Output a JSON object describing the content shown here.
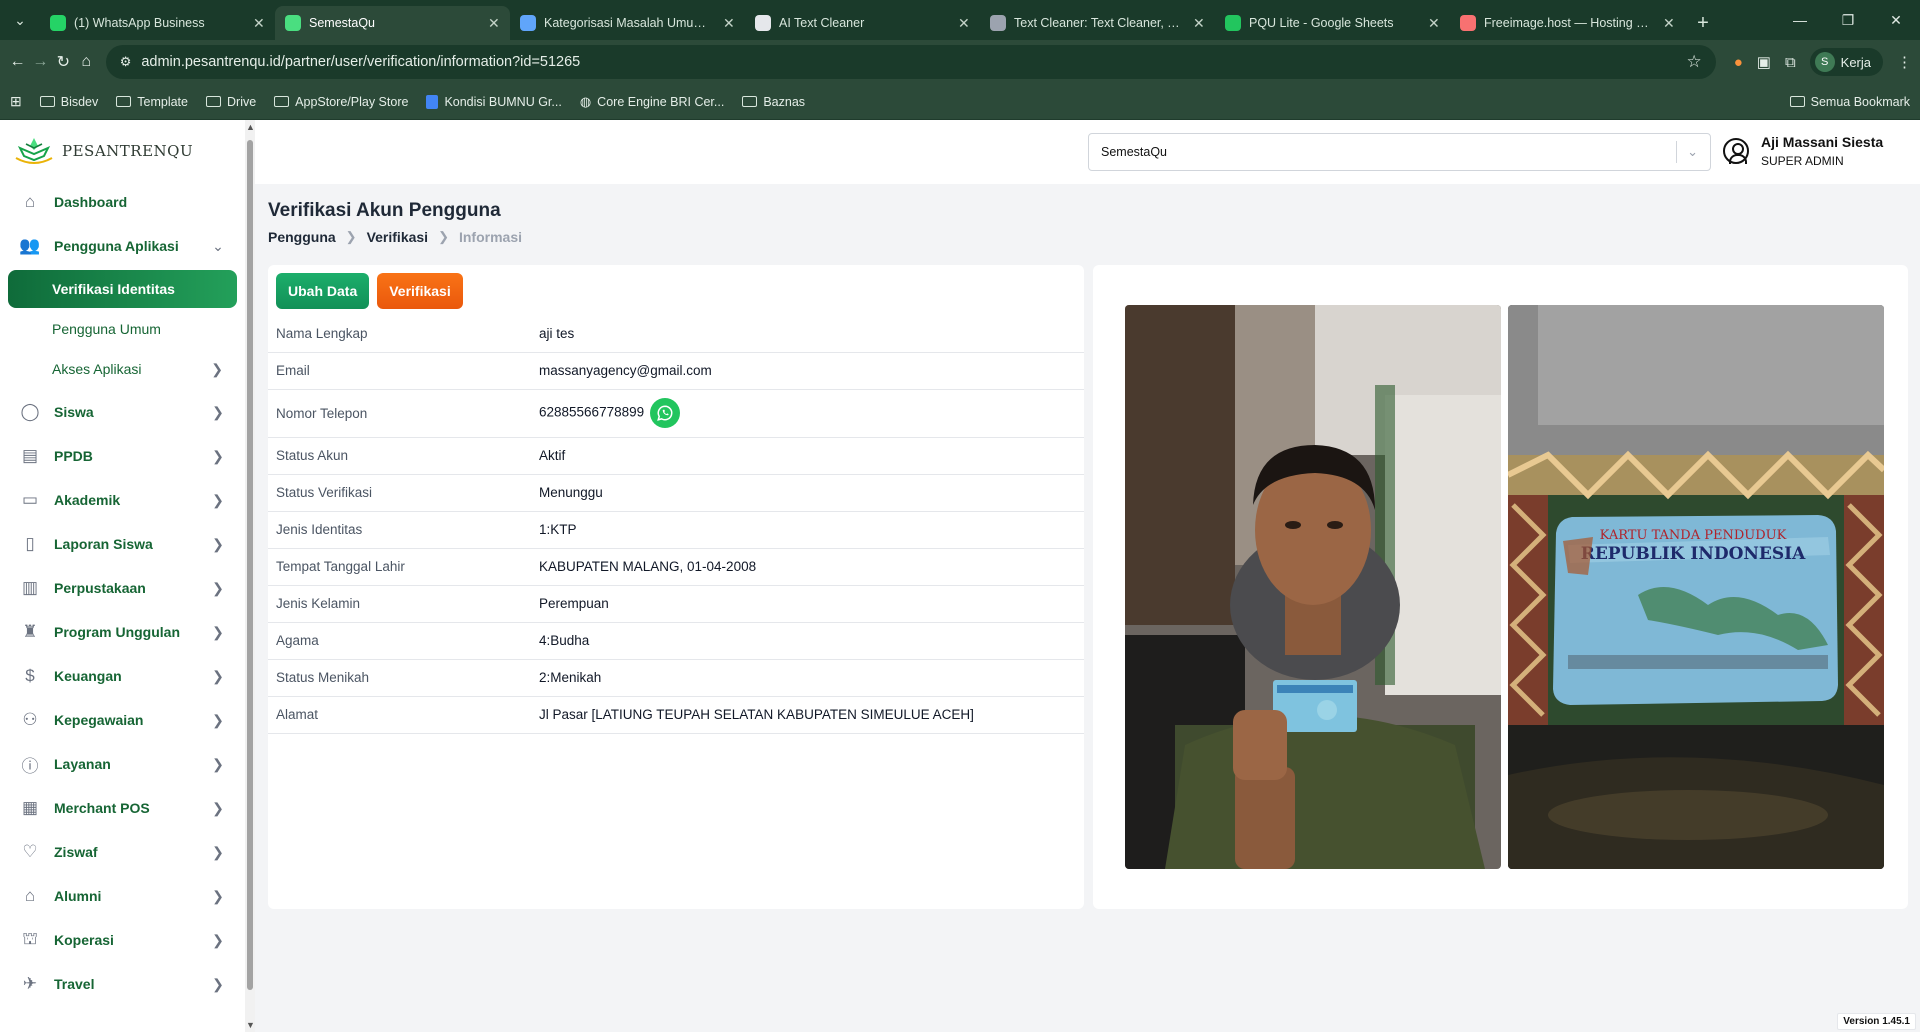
{
  "browser": {
    "tabs": [
      {
        "title": "(1) WhatsApp Business",
        "favicon": "whatsapp-icon",
        "color": "#25d366",
        "active": false
      },
      {
        "title": "SemestaQu",
        "favicon": "pesantrenqu-icon",
        "color": "#4ade80",
        "active": true
      },
      {
        "title": "Kategorisasi Masalah Umum Sh",
        "favicon": "gemini-icon",
        "color": "#60a5fa",
        "active": false
      },
      {
        "title": "AI Text Cleaner",
        "favicon": "brush-icon",
        "color": "#e5e7eb",
        "active": false
      },
      {
        "title": "Text Cleaner: Text Cleaner, Text",
        "favicon": "document-icon",
        "color": "#9ca3af",
        "active": false
      },
      {
        "title": "PQU Lite - Google Sheets",
        "favicon": "sheets-icon",
        "color": "#22c55e",
        "active": false
      },
      {
        "title": "Freeimage.host — Hosting Gam",
        "favicon": "freeimage-icon",
        "color": "#f87171",
        "active": false
      }
    ],
    "url": "admin.pesantrenqu.id/partner/user/verification/information?id=51265",
    "profile_label": "Kerja",
    "profile_initial": "S",
    "bookmarks": [
      {
        "label": "Bisdev",
        "icon": "folder-icon"
      },
      {
        "label": "Template",
        "icon": "folder-icon"
      },
      {
        "label": "Drive",
        "icon": "folder-icon"
      },
      {
        "label": "AppStore/Play Store",
        "icon": "folder-icon"
      },
      {
        "label": "Kondisi BUMNU Gr...",
        "icon": "docs-icon"
      },
      {
        "label": "Core Engine BRI Cer...",
        "icon": "globe-icon"
      },
      {
        "label": "Baznas",
        "icon": "folder-icon"
      }
    ],
    "bookmarks_all": "Semua Bookmark"
  },
  "app": {
    "logo_text": "PESANTRENQU",
    "brand_color": "#15803d",
    "sidebar": {
      "items": [
        {
          "label": "Dashboard",
          "icon": "home-icon",
          "chevron": false
        },
        {
          "label": "Pengguna Aplikasi",
          "icon": "users-icon",
          "chevron": "down"
        },
        {
          "label": "Siswa",
          "icon": "user-icon",
          "chevron": "right"
        },
        {
          "label": "PPDB",
          "icon": "clipboard-icon",
          "chevron": "right"
        },
        {
          "label": "Akademik",
          "icon": "doc-icon",
          "chevron": "right"
        },
        {
          "label": "Laporan Siswa",
          "icon": "report-icon",
          "chevron": "right"
        },
        {
          "label": "Perpustakaan",
          "icon": "book-icon",
          "chevron": "right"
        },
        {
          "label": "Program Unggulan",
          "icon": "trophy-icon",
          "chevron": "right"
        },
        {
          "label": "Keuangan",
          "icon": "dollar-icon",
          "chevron": "right"
        },
        {
          "label": "Kepegawaian",
          "icon": "staff-icon",
          "chevron": "right"
        },
        {
          "label": "Layanan",
          "icon": "info-icon",
          "chevron": "right"
        },
        {
          "label": "Merchant POS",
          "icon": "store-icon",
          "chevron": "right"
        },
        {
          "label": "Ziswaf",
          "icon": "heart-icon",
          "chevron": "right"
        },
        {
          "label": "Alumni",
          "icon": "graduation-icon",
          "chevron": "right"
        },
        {
          "label": "Koperasi",
          "icon": "bank-icon",
          "chevron": "right"
        },
        {
          "label": "Travel",
          "icon": "plane-icon",
          "chevron": "right"
        }
      ],
      "submenu": [
        {
          "label": "Verifikasi Identitas",
          "active": true
        },
        {
          "label": "Pengguna Umum",
          "active": false
        },
        {
          "label": "Akses Aplikasi",
          "active": false
        }
      ]
    },
    "topbar": {
      "selected_school": "SemestaQu",
      "user_name": "Aji Massani Siesta",
      "user_role": "SUPER ADMIN"
    },
    "page": {
      "title": "Verifikasi Akun Pengguna",
      "breadcrumb": [
        "Pengguna",
        "Verifikasi",
        "Informasi"
      ]
    },
    "actions": {
      "edit_label": "Ubah Data",
      "verify_label": "Verifikasi"
    },
    "details": [
      {
        "label": "Nama Lengkap",
        "value": "aji tes"
      },
      {
        "label": "Email",
        "value": "massanyagency@gmail.com"
      },
      {
        "label": "Nomor Telepon",
        "value": "62885566778899"
      },
      {
        "label": "Status Akun",
        "value": "Aktif"
      },
      {
        "label": "Status Verifikasi",
        "value": "Menunggu"
      },
      {
        "label": "Jenis Identitas",
        "value": "1:KTP"
      },
      {
        "label": "Tempat Tanggal Lahir",
        "value": "KABUPATEN MALANG, 01-04-2008"
      },
      {
        "label": "Jenis Kelamin",
        "value": "Perempuan"
      },
      {
        "label": "Agama",
        "value": "4:Budha"
      },
      {
        "label": "Status Menikah",
        "value": "2:Menikah"
      },
      {
        "label": "Alamat",
        "value": "Jl Pasar [LATIUNG TEUPAH SELATAN KABUPATEN SIMEULUE ACEH]"
      }
    ],
    "ktp_text": {
      "line1": "KARTU TANDA PENDUDUK",
      "line2": "REPUBLIK INDONESIA"
    },
    "version": "Version 1.45.1"
  }
}
